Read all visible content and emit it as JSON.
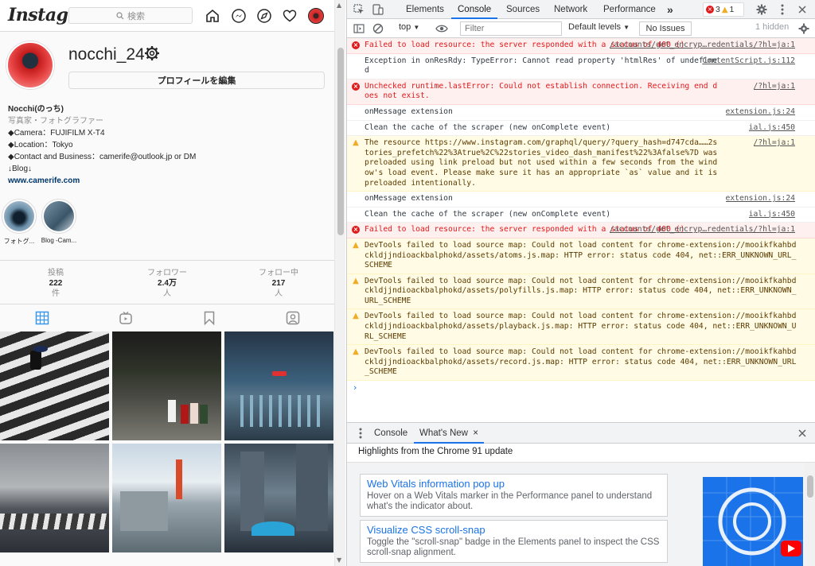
{
  "instagram": {
    "logo": "Instagram",
    "search_placeholder": "検索",
    "username": "nocchi_24",
    "edit_profile": "プロフィールを編集",
    "bio": {
      "name": "Nocchi(のっち)",
      "category": "写真家・フォトグラファー",
      "lines": [
        "◆Camera：FUJIFILM X-T4",
        "◆Location：Tokyo",
        "◆Contact and Business：camerife@outlook.jp or DM",
        "↓Blog↓"
      ],
      "link": "www.camerife.com"
    },
    "highlights": [
      {
        "label": "フォトグ..."
      },
      {
        "label": "Blog -Cam..."
      }
    ],
    "stats": [
      {
        "label": "投稿",
        "value": "222",
        "unit": "件"
      },
      {
        "label": "フォロワー",
        "value": "2.4万",
        "unit": "人"
      },
      {
        "label": "フォロー中",
        "value": "217",
        "unit": "人"
      }
    ]
  },
  "devtools": {
    "tabs": [
      "Elements",
      "Console",
      "Sources",
      "Network",
      "Performance"
    ],
    "active_tab": "Console",
    "more_tabs": "»",
    "error_count": "3",
    "warning_count": "1",
    "context": "top",
    "filter_placeholder": "Filter",
    "levels": "Default levels",
    "no_issues": "No Issues",
    "hidden": "1 hidden",
    "messages": [
      {
        "type": "error",
        "text": "Failed to load resource: the server responded with a status of 400 ()",
        "source": "/accounts/get_encryp…redentials/?hl=ja:1"
      },
      {
        "type": "log",
        "text": "Exception in onResRdy: TypeError: Cannot read property 'htmlRes' of undefined",
        "source": "ContentScript.js:112"
      },
      {
        "type": "error",
        "text": "Unchecked runtime.lastError: Could not establish connection. Receiving end does not exist.",
        "source": "/?hl=ja:1"
      },
      {
        "type": "log",
        "text": "onMessage extension",
        "source": "extension.js:24"
      },
      {
        "type": "log",
        "text": "Clean the cache of the scraper (new onComplete event)",
        "source": "ial.js:450"
      },
      {
        "type": "warn",
        "text": "The resource https://www.instagram.com/graphql/query/?query_hash=d747cda……2stories_prefetch%22%3Atrue%2C%22stories_video_dash_manifest%22%3Afalse%7D was preloaded using link preload but not used within a few seconds from the window's load event. Please make sure it has an appropriate `as` value and it is preloaded intentionally.",
        "source": "/?hl=ja:1"
      },
      {
        "type": "log",
        "text": "onMessage extension",
        "source": "extension.js:24"
      },
      {
        "type": "log",
        "text": "Clean the cache of the scraper (new onComplete event)",
        "source": "ial.js:450"
      },
      {
        "type": "error",
        "text": "Failed to load resource: the server responded with a status of 400 ()",
        "source": "/accounts/get_encryp…redentials/?hl=ja:1"
      },
      {
        "type": "warn",
        "text": "DevTools failed to load source map: Could not load content for chrome-extension://mooikfkahbdckldjjndioackbalphokd/assets/atoms.js.map: HTTP error: status code 404, net::ERR_UNKNOWN_URL_SCHEME",
        "source": ""
      },
      {
        "type": "warn",
        "text": "DevTools failed to load source map: Could not load content for chrome-extension://mooikfkahbdckldjjndioackbalphokd/assets/polyfills.js.map: HTTP error: status code 404, net::ERR_UNKNOWN_URL_SCHEME",
        "source": ""
      },
      {
        "type": "warn",
        "text": "DevTools failed to load source map: Could not load content for chrome-extension://mooikfkahbdckldjjndioackbalphokd/assets/playback.js.map: HTTP error: status code 404, net::ERR_UNKNOWN_URL_SCHEME",
        "source": ""
      },
      {
        "type": "warn",
        "text": "DevTools failed to load source map: Could not load content for chrome-extension://mooikfkahbdckldjjndioackbalphokd/assets/record.js.map: HTTP error: status code 404, net::ERR_UNKNOWN_URL_SCHEME",
        "source": ""
      }
    ],
    "prompt": "›",
    "drawer": {
      "tabs": [
        "Console",
        "What's New"
      ],
      "active": "What's New",
      "close": "×",
      "highlights_title": "Highlights from the Chrome 91 update",
      "cards": [
        {
          "title": "Web Vitals information pop up",
          "body": "Hover on a Web Vitals marker in the Performance panel to understand what's the indicator about."
        },
        {
          "title": "Visualize CSS scroll-snap",
          "body": "Toggle the \"scroll-snap\" badge in the Elements panel to inspect the CSS scroll-snap alignment."
        }
      ]
    }
  },
  "colors": {
    "error": "#e0191b",
    "warn": "#5c3c00",
    "accent": "#1a73e8"
  }
}
